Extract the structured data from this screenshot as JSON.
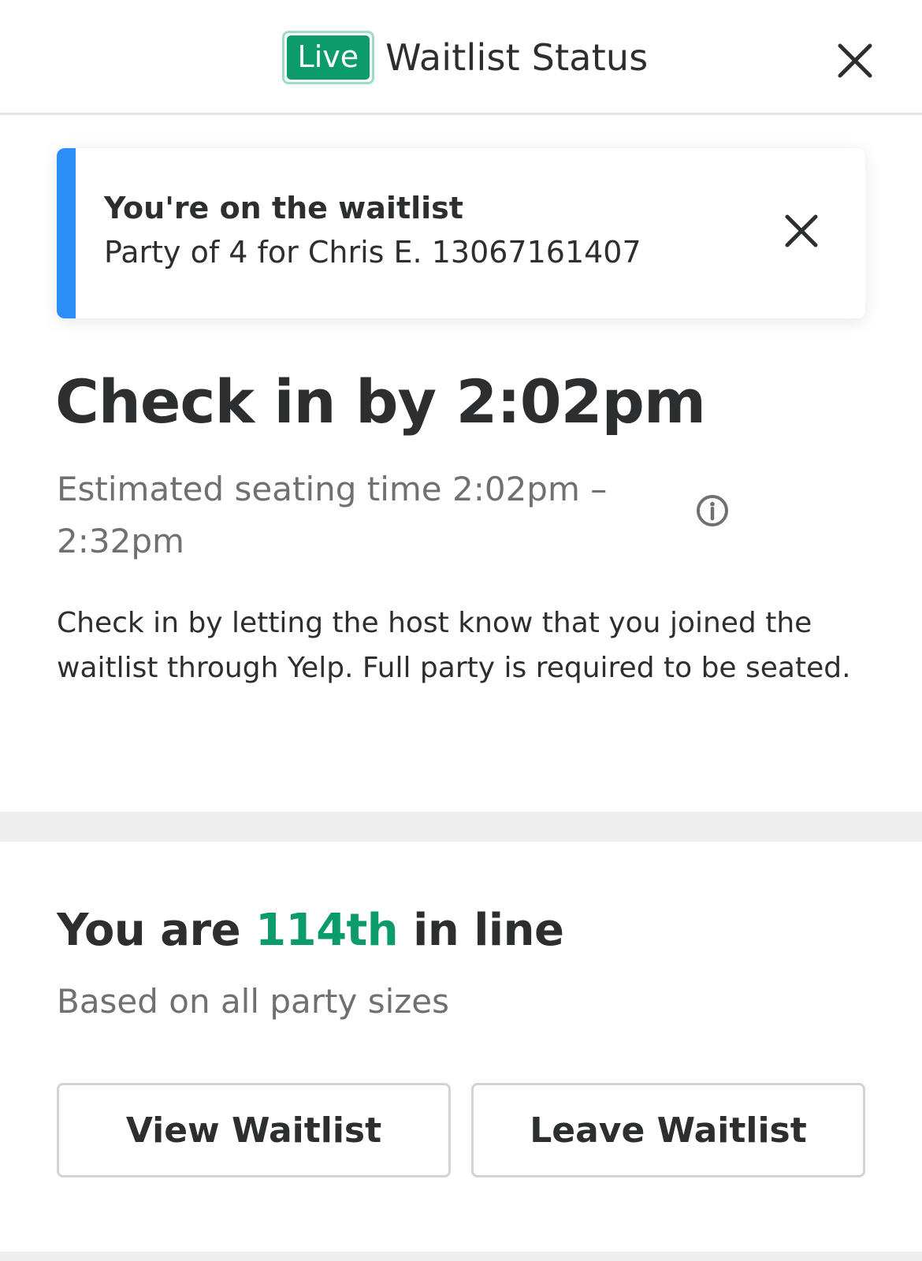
{
  "header": {
    "live_badge": "Live",
    "title": "Waitlist Status",
    "close_icon": "close-icon"
  },
  "notice": {
    "title": "You're on the waitlist",
    "subtitle": "Party of 4 for Chris E. 13067161407",
    "accent_color": "#2a8ff7",
    "close_icon": "close-icon"
  },
  "checkin": {
    "title": "Check in by 2:02pm",
    "estimate": "Estimated seating time 2:02pm – 2:32pm",
    "info_icon": "info-icon",
    "instructions": "Check in by letting the host know that you joined the waitlist through Yelp. Full party is required to be seated."
  },
  "position": {
    "prefix": "You are ",
    "rank": "114th",
    "suffix": " in line",
    "subtitle": "Based on all party sizes",
    "accent_color": "#0c9b6a"
  },
  "actions": {
    "view_label": "View Waitlist",
    "leave_label": "Leave Waitlist"
  }
}
